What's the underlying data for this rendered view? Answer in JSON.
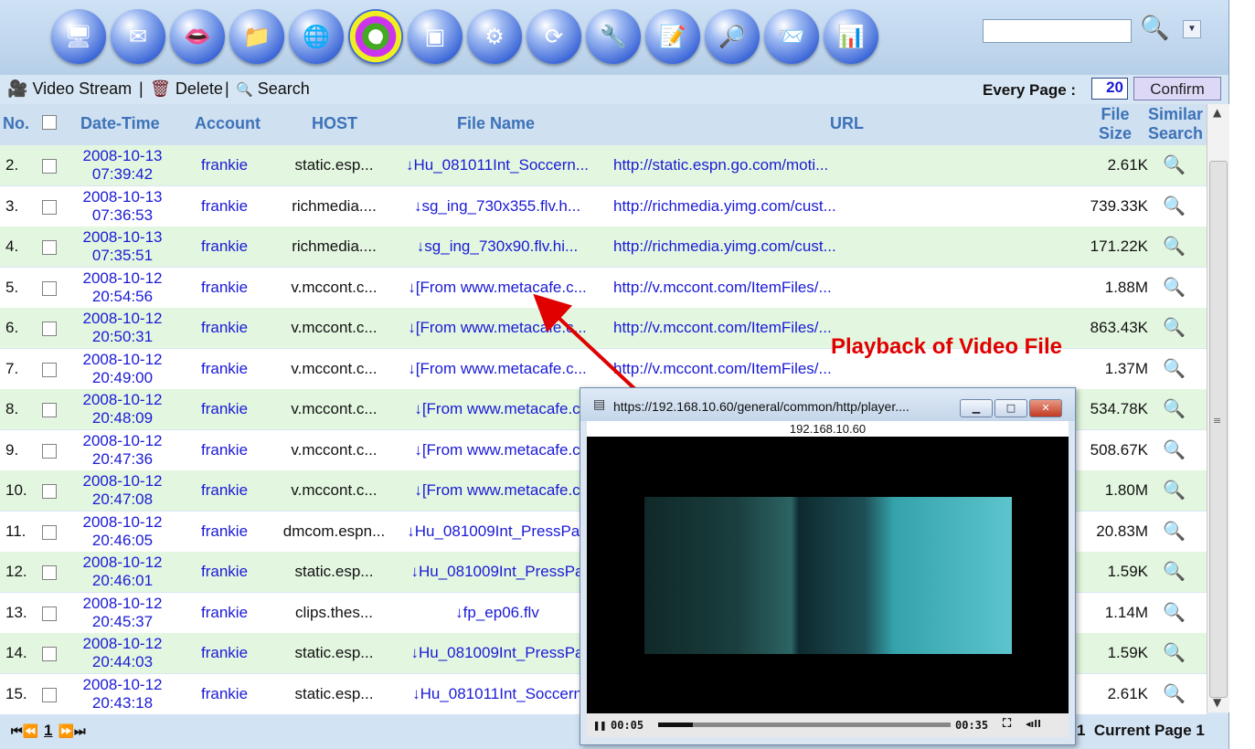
{
  "toolbar": {
    "icons": [
      "computer-icon",
      "mail-icon",
      "lips-icon",
      "folder-icon",
      "network-icon",
      "ie-browser-icon",
      "terminal-icon",
      "settings-gear-icon",
      "refresh-icon",
      "wrench-icon",
      "notes-icon",
      "folder-search-icon",
      "mail-forward-icon",
      "bar-chart-icon"
    ],
    "video_stream": "Video Stream",
    "sep1": "|",
    "delete": "Delete",
    "sep2": "|",
    "search": "Search",
    "every_page_label": "Every Page :",
    "per_page_value": "20",
    "confirm": "Confirm"
  },
  "search": {
    "value": ""
  },
  "table": {
    "headers": {
      "no": "No.",
      "datetime": "Date-Time",
      "account": "Account",
      "host": "HOST",
      "filename": "File Name",
      "url": "URL",
      "filesize_1": "File",
      "filesize_2": "Size",
      "similar_1": "Similar",
      "similar_2": "Search"
    },
    "rows": [
      {
        "no": "2.",
        "date": "2008-10-13",
        "time": "07:39:42",
        "account": "frankie",
        "host": "static.esp...",
        "file": "↓Hu_081011Int_Soccern...",
        "url": "http://static.espn.go.com/moti...",
        "size": "2.61K"
      },
      {
        "no": "3.",
        "date": "2008-10-13",
        "time": "07:36:53",
        "account": "frankie",
        "host": "richmedia....",
        "file": "↓sg_ing_730x355.flv.h...",
        "url": "http://richmedia.yimg.com/cust...",
        "size": "739.33K"
      },
      {
        "no": "4.",
        "date": "2008-10-13",
        "time": "07:35:51",
        "account": "frankie",
        "host": "richmedia....",
        "file": "↓sg_ing_730x90.flv.hi...",
        "url": "http://richmedia.yimg.com/cust...",
        "size": "171.22K"
      },
      {
        "no": "5.",
        "date": "2008-10-12",
        "time": "20:54:56",
        "account": "frankie",
        "host": "v.mccont.c...",
        "file": "↓[From www.metacafe.c...",
        "url": "http://v.mccont.com/ItemFiles/...",
        "size": "1.88M"
      },
      {
        "no": "6.",
        "date": "2008-10-12",
        "time": "20:50:31",
        "account": "frankie",
        "host": "v.mccont.c...",
        "file": "↓[From www.metacafe.c...",
        "url": "http://v.mccont.com/ItemFiles/...",
        "size": "863.43K"
      },
      {
        "no": "7.",
        "date": "2008-10-12",
        "time": "20:49:00",
        "account": "frankie",
        "host": "v.mccont.c...",
        "file": "↓[From www.metacafe.c...",
        "url": "http://v.mccont.com/ItemFiles/...",
        "size": "1.37M"
      },
      {
        "no": "8.",
        "date": "2008-10-12",
        "time": "20:48:09",
        "account": "frankie",
        "host": "v.mccont.c...",
        "file": "↓[From www.metacafe.c",
        "url": "",
        "size": "534.78K"
      },
      {
        "no": "9.",
        "date": "2008-10-12",
        "time": "20:47:36",
        "account": "frankie",
        "host": "v.mccont.c...",
        "file": "↓[From www.metacafe.c",
        "url": "",
        "size": "508.67K"
      },
      {
        "no": "10.",
        "date": "2008-10-12",
        "time": "20:47:08",
        "account": "frankie",
        "host": "v.mccont.c...",
        "file": "↓[From www.metacafe.c",
        "url": "",
        "size": "1.80M"
      },
      {
        "no": "11.",
        "date": "2008-10-12",
        "time": "20:46:05",
        "account": "frankie",
        "host": "dmcom.espn...",
        "file": "↓Hu_081009Int_PressPas",
        "url": "",
        "size": "20.83M"
      },
      {
        "no": "12.",
        "date": "2008-10-12",
        "time": "20:46:01",
        "account": "frankie",
        "host": "static.esp...",
        "file": "↓Hu_081009Int_PressPa",
        "url": "",
        "size": "1.59K"
      },
      {
        "no": "13.",
        "date": "2008-10-12",
        "time": "20:45:37",
        "account": "frankie",
        "host": "clips.thes...",
        "file": "↓fp_ep06.flv",
        "url": "",
        "size": "1.14M"
      },
      {
        "no": "14.",
        "date": "2008-10-12",
        "time": "20:44:03",
        "account": "frankie",
        "host": "static.esp...",
        "file": "↓Hu_081009Int_PressPa",
        "url": "",
        "size": "1.59K"
      },
      {
        "no": "15.",
        "date": "2008-10-12",
        "time": "20:43:18",
        "account": "frankie",
        "host": "static.esp...",
        "file": "↓Hu_081011Int_Soccern",
        "url": "",
        "size": "2.61K"
      }
    ]
  },
  "footer": {
    "first": "⏮",
    "prev": "⏪",
    "page": "1",
    "next": "⏩",
    "last": "⏭",
    "current_page_text": "1  Current Page 1"
  },
  "annotation": {
    "text": "Playback of Video File",
    "color": "#e00000"
  },
  "player": {
    "title": "https://192.168.10.60/general/common/http/player....",
    "host": "192.168.10.60",
    "current_time": "00:05",
    "duration": "00:35",
    "progress": 0.12
  }
}
